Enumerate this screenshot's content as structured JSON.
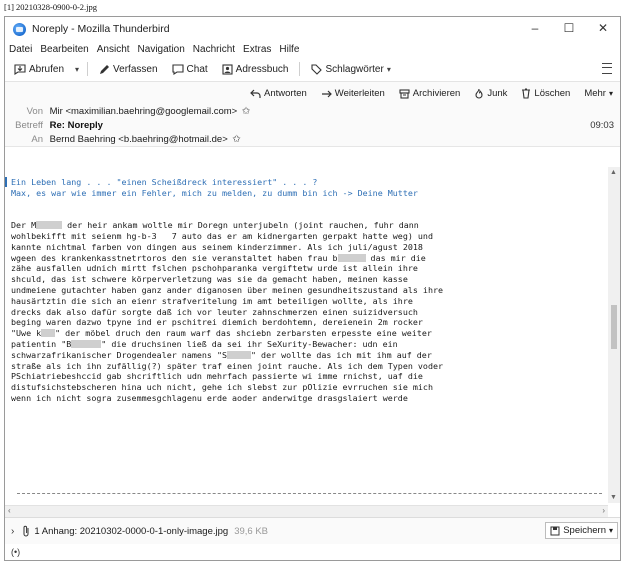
{
  "image_label": "[1] 20210328-0900-0-2.jpg",
  "window": {
    "title": "Noreply - Mozilla Thunderbird",
    "minimize": "–",
    "maximize": "☐",
    "close": "✕"
  },
  "menu": [
    "Datei",
    "Bearbeiten",
    "Ansicht",
    "Navigation",
    "Nachricht",
    "Extras",
    "Hilfe"
  ],
  "toolbar": {
    "get_mail": "Abrufen",
    "compose": "Verfassen",
    "chat": "Chat",
    "address_book": "Adressbuch",
    "tags": "Schlagwörter"
  },
  "actions": [
    "Antworten",
    "Weiterleiten",
    "Archivieren",
    "Junk",
    "Löschen",
    "Mehr"
  ],
  "header": {
    "from_label": "Von",
    "from_value": "Mir <maximilian.baehring@googlemail.com>",
    "subject_label": "Betreff",
    "subject_value": "Re: Noreply",
    "time": "09:03",
    "to_label": "An",
    "to_value": "Bernd Baehring <b.baehring@hotmail.de>"
  },
  "body": {
    "quote_1": "Ein Leben lang . . . \"einen Scheißdreck interessiert\" . . . ?",
    "quote_2": "Max, es war wie immer ein Fehler, mich zu melden, zu dumm bin ich -> Deine Mutter",
    "l1a": "Der M",
    "l1b": " der heir ankam woltle mir Doregn unterjubeln (joint rauchen, fuhr dann",
    "l2": "wohlbekifft mit seienm hg-b-3   7 auto das er am kidnergarten gerpakt hatte weg) und",
    "l3": "kannte nichtmal farben von dingen aus seinem kinderzimmer. Als ich juli/agust 2018",
    "l4a": "wgeen des krankenkasstnetrtoros den sie veranstaltet haben frau b",
    "l4b": " das mir die",
    "l5": "zähe ausfallen udnich mirtt fslchen pschohparanka vergiftetw urde ist allein ihre",
    "l6": "shculd, das ist schwere körperverletzung was sie da gemacht haben, meinen kasse",
    "l7": "undmeiene gutachter haben ganz ander diganosen über meinen gesundheitszustand als ihre",
    "l8": "hausärtztin die sich an eienr strafveritelung im amt beteiligen wollte, als ihre",
    "l9": "drecks dak also dafür sorgte daß ich vor leuter zahnschmerzen einen suizidversuch",
    "l10": "beging waren dazwo tpyne ind er pschitrei diemich berdohtemn, dereienein 2m rocker",
    "l11a": "\"Uwe k",
    "l11b": "\" der möbel druch den raum warf das shciebn zerbarsten erpesste eine weiter",
    "l12a": "patientin \"B",
    "l12b": "\" die druchsinen ließ da sei ihr SeXurity-Bewacher: udn ein",
    "l13a": "schwarzafrikanischer Drogendealer namens \"S",
    "l13b": "\" der wollte das ich mit ihm auf der",
    "l14": "straße als ich ihn zufällig(?) später traf einen joint rauche. Als ich dem Typen voder",
    "l15": "PSchiatriebeshccid gab shcriftlich udn mehrfach passierte wi imme rnichst, uaf die",
    "l16": "distufsichstebscheren hina uch nicht, gehe ich slebst zur pOlizie evrruchen sie mich",
    "l17": "wenn ich nicht sogra zusemmesgchlagenu erde aoder anderwitge drasgslaiert werde"
  },
  "attachment": {
    "label": "1 Anhang: 20210302-0000-0-1-only-image.jpg",
    "size": "39,6 KB",
    "save": "Speichern"
  },
  "status": {
    "wifi": "(•)"
  },
  "colors": {
    "quote": "#2e6fb5",
    "background": "#ffffff",
    "border": "#9a9a9a"
  }
}
